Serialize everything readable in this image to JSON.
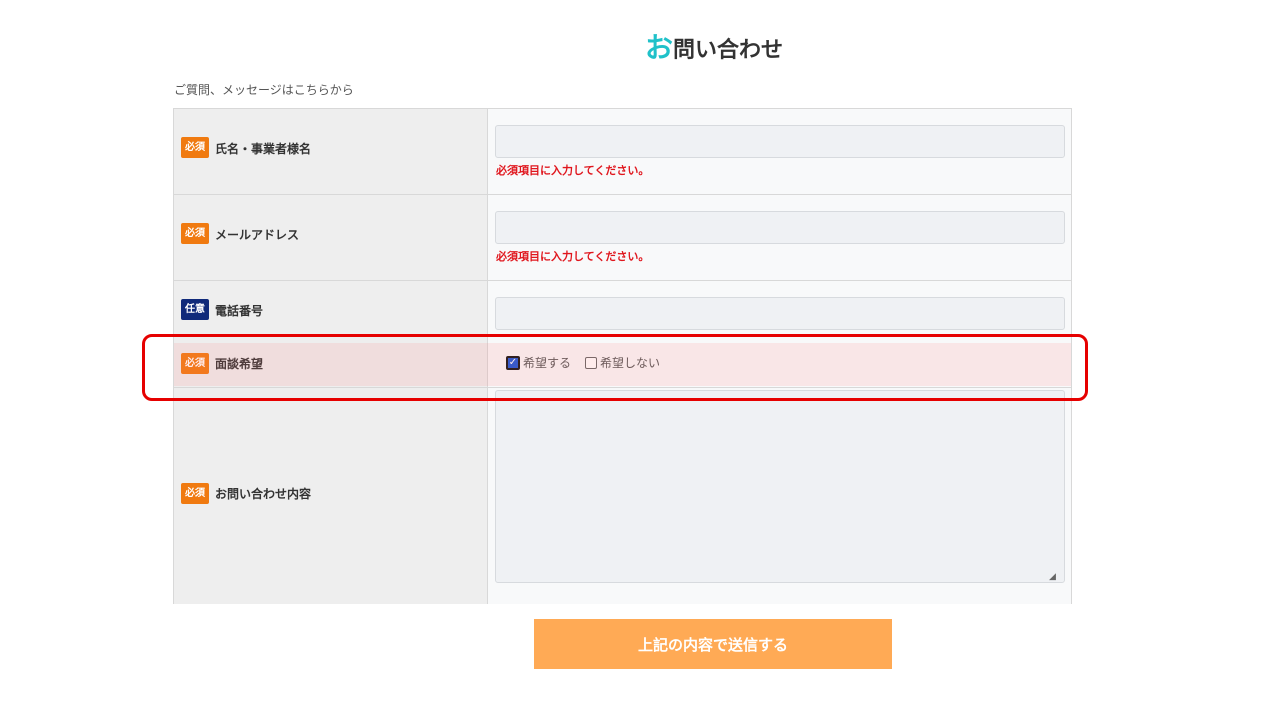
{
  "page": {
    "title_accent": "お",
    "title_rest": "問い合わせ",
    "subtitle": "ご質問、メッセージはこちらから"
  },
  "form": {
    "fields": [
      {
        "badge": "必須",
        "label": "氏名・事業者様名",
        "value": "",
        "error": "必須項目に入力してください。"
      },
      {
        "badge": "必須",
        "label": "メールアドレス",
        "value": "",
        "error": "必須項目に入力してください。"
      },
      {
        "badge": "任意",
        "label": "電話番号",
        "value": ""
      },
      {
        "badge": "必須",
        "label": "面談希望",
        "options": [
          {
            "label": "希望する",
            "checked": true
          },
          {
            "label": "希望しない",
            "checked": false
          }
        ]
      },
      {
        "badge": "必須",
        "label": "お問い合わせ内容",
        "value": ""
      }
    ],
    "submit_label": "上記の内容で送信する"
  },
  "colors": {
    "required_badge": "#f07a10",
    "optional_badge": "#102a7a",
    "error": "#e0161d",
    "submit": "#ffaa55",
    "title_accent": "#1fc1c9",
    "highlight": "#e60000"
  }
}
